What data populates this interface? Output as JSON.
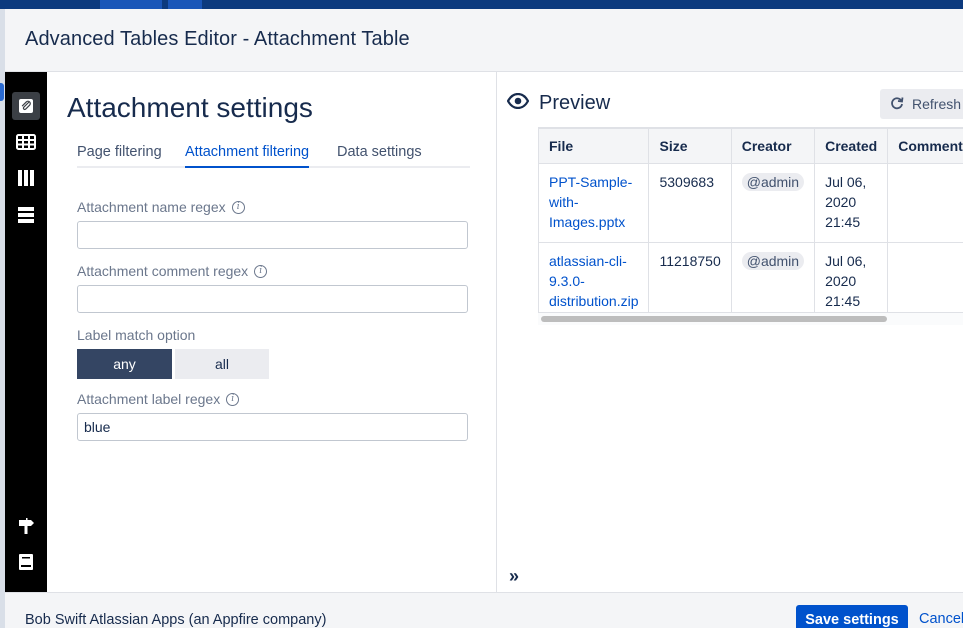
{
  "window": {
    "title": "Advanced Tables Editor - Attachment Table"
  },
  "sidebar": {
    "icons": [
      "attachment-icon",
      "table-icon",
      "columns-icon",
      "rows-icon",
      "signpost-icon",
      "book-icon"
    ]
  },
  "settings": {
    "heading": "Attachment settings",
    "tabs": [
      {
        "label": "Page filtering"
      },
      {
        "label": "Attachment filtering"
      },
      {
        "label": "Data settings"
      }
    ],
    "selected_tab": "Attachment filtering",
    "fields": {
      "name_regex": {
        "label": "Attachment name regex",
        "value": ""
      },
      "comment_regex": {
        "label": "Attachment comment regex",
        "value": ""
      },
      "label_match": {
        "label": "Label match option",
        "options": [
          "any",
          "all"
        ],
        "selected": "any"
      },
      "label_regex": {
        "label": "Attachment label regex",
        "value": "blue"
      }
    }
  },
  "preview": {
    "title": "Preview",
    "refresh_label": "Refresh",
    "columns": [
      "File",
      "Size",
      "Creator",
      "Created",
      "Comment"
    ],
    "rows": [
      {
        "file": "PPT-Sample-with-Images.pptx",
        "size": "5309683",
        "creator": "@admin",
        "created": "Jul 06, 2020 21:45"
      },
      {
        "file": "atlassian-cli-9.3.0-distribution.zip",
        "size": "11218750",
        "creator": "@admin",
        "created": "Jul 06, 2020 21:45"
      }
    ],
    "expand_icon": "double-chevron-right-icon"
  },
  "footer": {
    "brand": "Bob Swift Atlassian Apps (an Appfire company)",
    "save_label": "Save settings",
    "cancel_label": "Cancel"
  },
  "colors": {
    "primary": "#0052cc",
    "toggle_on": "#344563",
    "sidebar_bg": "#000000"
  }
}
